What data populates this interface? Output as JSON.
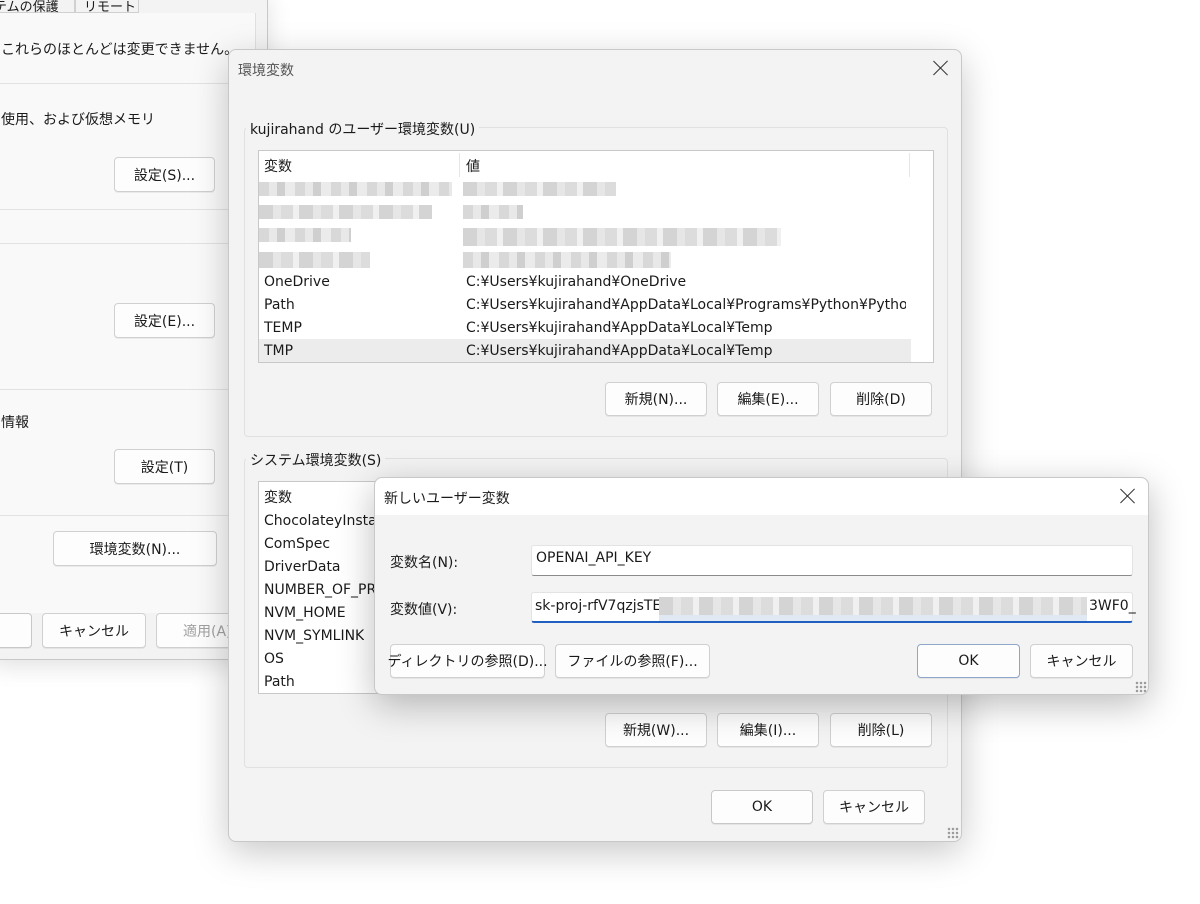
{
  "background_window": {
    "tabs": [
      "テムの保護",
      "リモート"
    ],
    "notice": "これらのほとんどは変更できません。",
    "performance_text": "使用、および仮想メモリ",
    "settings_s": "設定(S)...",
    "settings_e": "設定(E)...",
    "info_text": "情報",
    "settings_t": "設定(T)",
    "env_vars_button": "環境変数(N)...",
    "cancel": "キャンセル",
    "apply": "適用(A)"
  },
  "env_dialog": {
    "title": "環境変数",
    "user_group_label": "kujirahand のユーザー環境変数(U)",
    "col_var": "変数",
    "col_val": "値",
    "user_rows": [
      {
        "name": "OneDrive",
        "value": "C:¥Users¥kujirahand¥OneDrive"
      },
      {
        "name": "Path",
        "value": "C:¥Users¥kujirahand¥AppData¥Local¥Programs¥Python¥Pytho..."
      },
      {
        "name": "TEMP",
        "value": "C:¥Users¥kujirahand¥AppData¥Local¥Temp"
      },
      {
        "name": "TMP",
        "value": "C:¥Users¥kujirahand¥AppData¥Local¥Temp"
      }
    ],
    "user_new": "新規(N)...",
    "user_edit": "編集(E)...",
    "user_delete": "削除(D)",
    "system_group_label": "システム環境変数(S)",
    "system_rows": [
      "ChocolateyInstal",
      "ComSpec",
      "DriverData",
      "NUMBER_OF_PR",
      "NVM_HOME",
      "NVM_SYMLINK",
      "OS",
      "Path"
    ],
    "system_new": "新規(W)...",
    "system_edit": "編集(I)...",
    "system_delete": "削除(L)",
    "ok": "OK",
    "cancel": "キャンセル"
  },
  "new_var_dialog": {
    "title": "新しいユーザー変数",
    "name_label": "変数名(N):",
    "name_value": "OPENAI_API_KEY",
    "value_label": "変数値(V):",
    "value_prefix": "sk-proj-rfV7qzjsTE",
    "value_suffix": "3WF0_",
    "browse_dir": "ディレクトリの参照(D)...",
    "browse_file": "ファイルの参照(F)...",
    "ok": "OK",
    "cancel": "キャンセル"
  },
  "colors": {
    "window_bg": "#f3f3f3",
    "focus_accent": "#1f5fbf",
    "selected_row": "#ececec"
  }
}
